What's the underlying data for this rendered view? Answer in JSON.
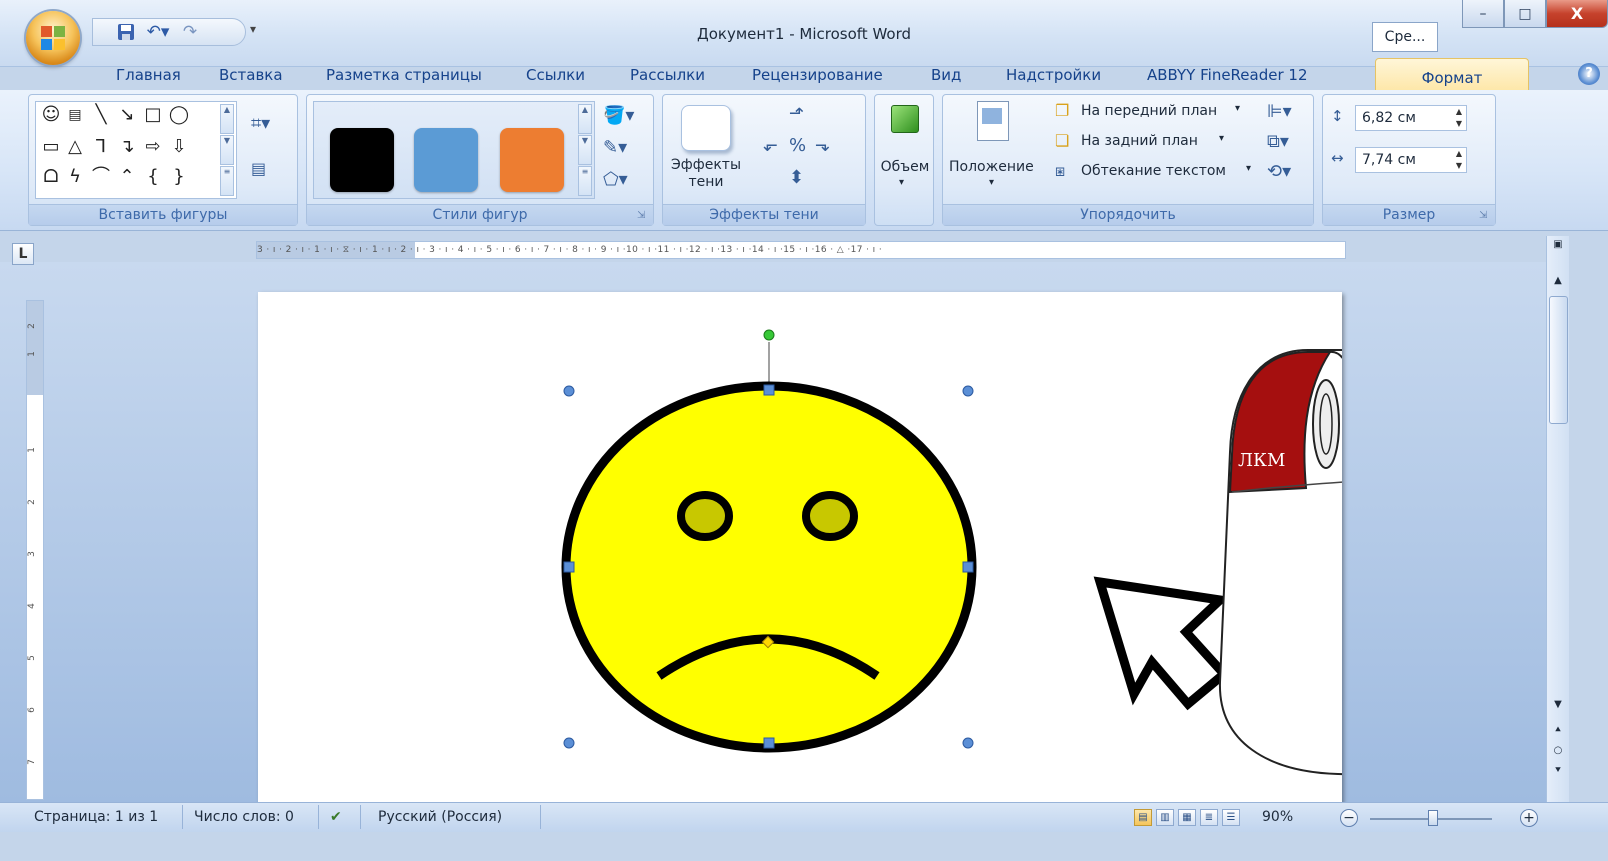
{
  "window": {
    "title": "Документ1 - Microsoft Word",
    "minimize": "–",
    "maximize": "□",
    "close": "X",
    "side_button": "Сре..."
  },
  "tabs": [
    {
      "label": "Главная"
    },
    {
      "label": "Вставка"
    },
    {
      "label": "Разметка страницы"
    },
    {
      "label": "Ссылки"
    },
    {
      "label": "Рассылки"
    },
    {
      "label": "Рецензирование"
    },
    {
      "label": "Вид"
    },
    {
      "label": "Надстройки"
    },
    {
      "label": "ABBYY FineReader 12"
    },
    {
      "label": "Формат",
      "active": true
    }
  ],
  "help": "?",
  "ribbon": {
    "groups": {
      "insert_shapes": "Вставить фигуры",
      "shape_styles": "Стили фигур",
      "shadow_effects": "Эффекты тени",
      "volume": "Объем",
      "arrange": "Упорядочить",
      "size": "Размер"
    },
    "shadow_effects_button": "Эффекты тени",
    "volume_button": "Объем",
    "position_button": "Положение",
    "bring_forward": "На передний план",
    "send_backward": "На задний план",
    "text_wrapping": "Обтекание текстом",
    "height_value": "6,82 см",
    "width_value": "7,74 см",
    "style_colors": [
      "#000000",
      "#5b9bd5",
      "#ed7d31"
    ]
  },
  "ruler": {
    "horizontal": "3 · ı · 2 · ı · 1 · ı · ⧖ · ı · 1 · ı · 2 · ı · 3 · ı · 4 · ı · 5 · ı · 6 · ı · 7 · ı · 8 · ı · 9 · ı ·10 · ı ·11 · ı ·12 · ı ·13 · ı ·14 · ı ·15 · ı ·16 · △ ·17 · ı ·",
    "vertical_numbers": [
      "2",
      "1",
      "1",
      "2",
      "3",
      "4",
      "5",
      "6",
      "7"
    ]
  },
  "canvas": {
    "mouse_label": "ЛКМ",
    "smiley_color": "#ffff00",
    "mouse_button_color": "#a50f0f"
  },
  "statusbar": {
    "page": "Страница: 1 из 1",
    "words": "Число слов: 0",
    "language": "Русский (Россия)",
    "zoom": "90%"
  }
}
